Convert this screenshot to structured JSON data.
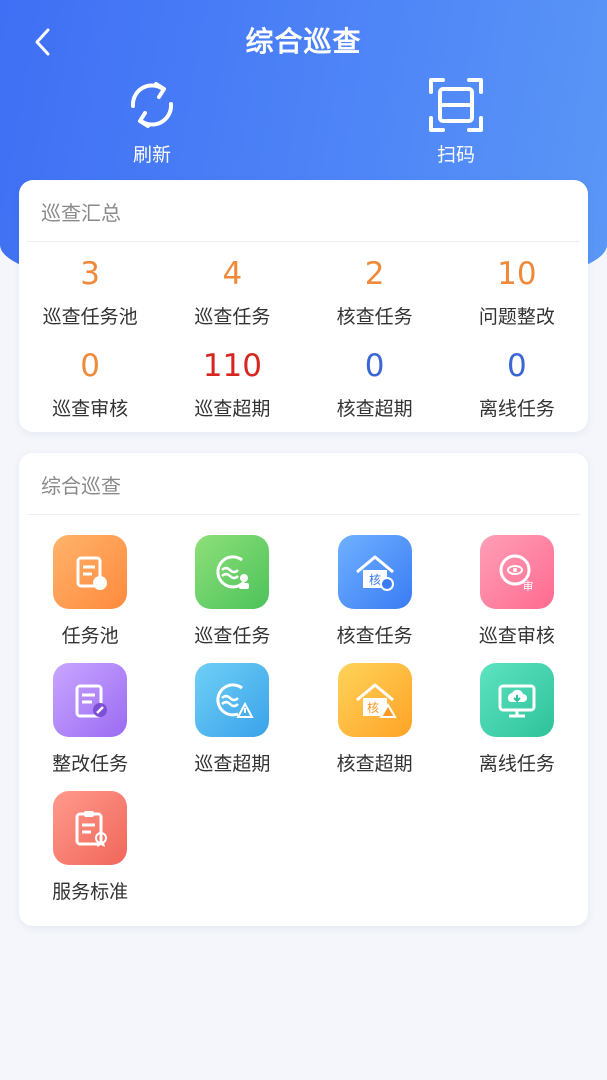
{
  "header": {
    "title": "综合巡查",
    "actions": [
      {
        "label": "刷新",
        "icon": "refresh-icon"
      },
      {
        "label": "扫码",
        "icon": "scan-icon"
      }
    ]
  },
  "summary": {
    "title": "巡查汇总",
    "stats": [
      {
        "value": "3",
        "label": "巡查任务池",
        "color": "#ee8a3a"
      },
      {
        "value": "4",
        "label": "巡查任务",
        "color": "#ee8a3a"
      },
      {
        "value": "2",
        "label": "核查任务",
        "color": "#ee8a3a"
      },
      {
        "value": "10",
        "label": "问题整改",
        "color": "#ee8a3a"
      },
      {
        "value": "0",
        "label": "巡查审核",
        "color": "#ee8a3a"
      },
      {
        "value": "110",
        "label": "巡查超期",
        "color": "#d6261f"
      },
      {
        "value": "0",
        "label": "核查超期",
        "color": "#3a66d6"
      },
      {
        "value": "0",
        "label": "离线任务",
        "color": "#3a66d6"
      }
    ]
  },
  "modules": {
    "title": "综合巡查",
    "items": [
      {
        "label": "任务池",
        "icon": "task-pool-icon",
        "color_from": "#ffb36b",
        "color_to": "#ff8a3d"
      },
      {
        "label": "巡查任务",
        "icon": "patrol-task-icon",
        "color_from": "#8ee07a",
        "color_to": "#4dc25a"
      },
      {
        "label": "核查任务",
        "icon": "verify-task-icon",
        "color_from": "#6fb1ff",
        "color_to": "#3a7cf3"
      },
      {
        "label": "巡查审核",
        "icon": "patrol-review-icon",
        "color_from": "#ff9fb7",
        "color_to": "#ff6a90"
      },
      {
        "label": "整改任务",
        "icon": "rectify-task-icon",
        "color_from": "#c9a6ff",
        "color_to": "#9b6bf2"
      },
      {
        "label": "巡查超期",
        "icon": "patrol-overdue-icon",
        "color_from": "#6fd0f5",
        "color_to": "#3aa2ea"
      },
      {
        "label": "核查超期",
        "icon": "verify-overdue-icon",
        "color_from": "#ffd35a",
        "color_to": "#ffa326"
      },
      {
        "label": "离线任务",
        "icon": "offline-task-icon",
        "color_from": "#5ee3c0",
        "color_to": "#2ec29b"
      },
      {
        "label": "服务标准",
        "icon": "service-standard-icon",
        "color_from": "#ff9a8c",
        "color_to": "#f0665a"
      }
    ]
  }
}
